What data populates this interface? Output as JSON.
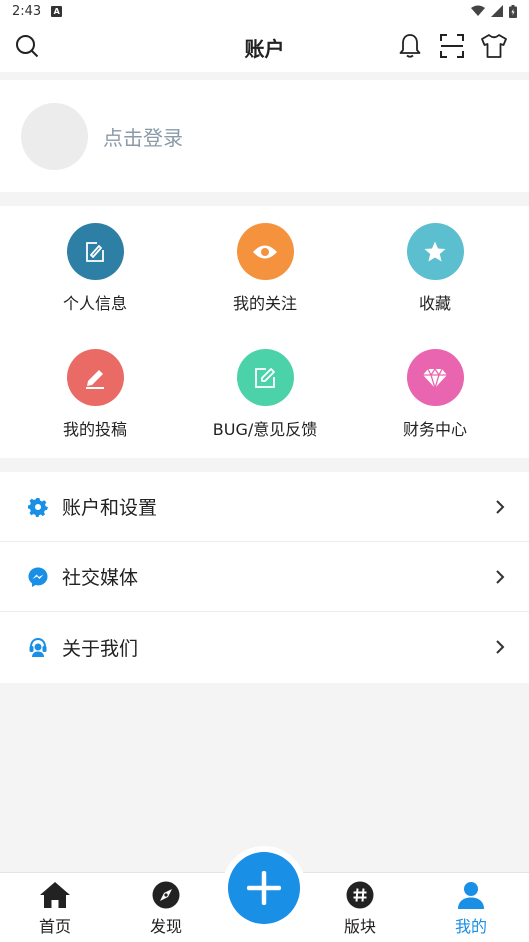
{
  "status": {
    "time": "2:43",
    "notif_glyph": "A"
  },
  "header": {
    "title": "账户"
  },
  "profile": {
    "login_text": "点击登录"
  },
  "grid": {
    "items": [
      {
        "label": "个人信息",
        "color": "#2e7fa6",
        "icon": "edit-icon"
      },
      {
        "label": "我的关注",
        "color": "#f5923e",
        "icon": "eye-icon"
      },
      {
        "label": "收藏",
        "color": "#5bbfcf",
        "icon": "star-icon"
      },
      {
        "label": "我的投稿",
        "color": "#ea6b66",
        "icon": "pencil-icon"
      },
      {
        "label": "BUG/意见反馈",
        "color": "#4cd2a8",
        "icon": "feedback-icon"
      },
      {
        "label": "财务中心",
        "color": "#e965b0",
        "icon": "diamond-icon"
      }
    ]
  },
  "menu": {
    "items": [
      {
        "label": "账户和设置",
        "icon": "gear-icon"
      },
      {
        "label": "社交媒体",
        "icon": "messenger-icon"
      },
      {
        "label": "关于我们",
        "icon": "headset-icon"
      }
    ]
  },
  "tabs": {
    "items": [
      {
        "label": "首页",
        "icon": "home-icon"
      },
      {
        "label": "发现",
        "icon": "compass-icon"
      },
      {
        "label": "版块",
        "icon": "hashtag-icon"
      },
      {
        "label": "我的",
        "icon": "user-icon",
        "active": true
      }
    ]
  },
  "colors": {
    "accent": "#1a8fe6",
    "text": "#222222",
    "muted": "#8a9aa8",
    "background": "#f4f4f4"
  }
}
